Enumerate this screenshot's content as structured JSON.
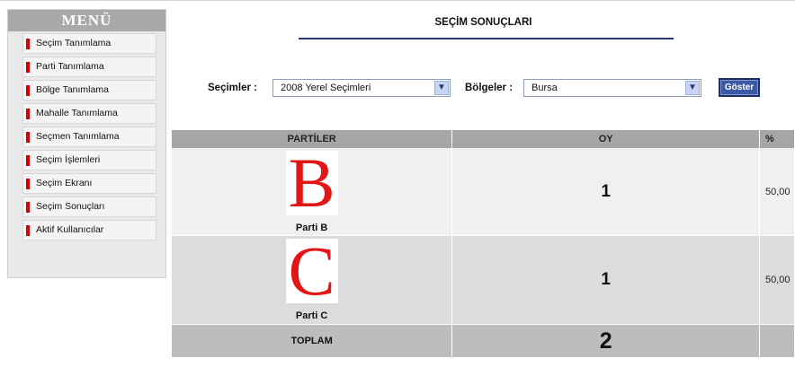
{
  "sidebar": {
    "title": "MENÜ",
    "items": [
      {
        "label": "Seçim Tanımlama"
      },
      {
        "label": "Parti Tanımlama"
      },
      {
        "label": "Bölge Tanımlama"
      },
      {
        "label": "Mahalle Tanımlama"
      },
      {
        "label": "Seçmen Tanımlama"
      },
      {
        "label": "Seçim İşlemleri"
      },
      {
        "label": "Seçim Ekranı"
      },
      {
        "label": "Seçim Sonuçları"
      },
      {
        "label": "Aktif Kullanıcılar"
      }
    ]
  },
  "page": {
    "title": "SEÇİM SONUÇLARI"
  },
  "filters": {
    "elections_label": "Seçimler :",
    "elections_value": "2008 Yerel Seçimleri",
    "regions_label": "Bölgeler :",
    "regions_value": "Bursa",
    "show_button": "Göster"
  },
  "table": {
    "headers": {
      "parties": "PARTİLER",
      "votes": "OY",
      "percent": "%"
    },
    "rows": [
      {
        "logo_letter": "B",
        "party": "Parti B",
        "votes": "1",
        "percent": "50,00"
      },
      {
        "logo_letter": "C",
        "party": "Parti C",
        "votes": "1",
        "percent": "50,00"
      }
    ],
    "total": {
      "label": "TOPLAM",
      "votes": "2"
    }
  },
  "colors": {
    "menu_marker": "#d40000",
    "logo_letter": "#e11616",
    "title_rule": "#2b3a78",
    "button": "#3b5aa6"
  }
}
